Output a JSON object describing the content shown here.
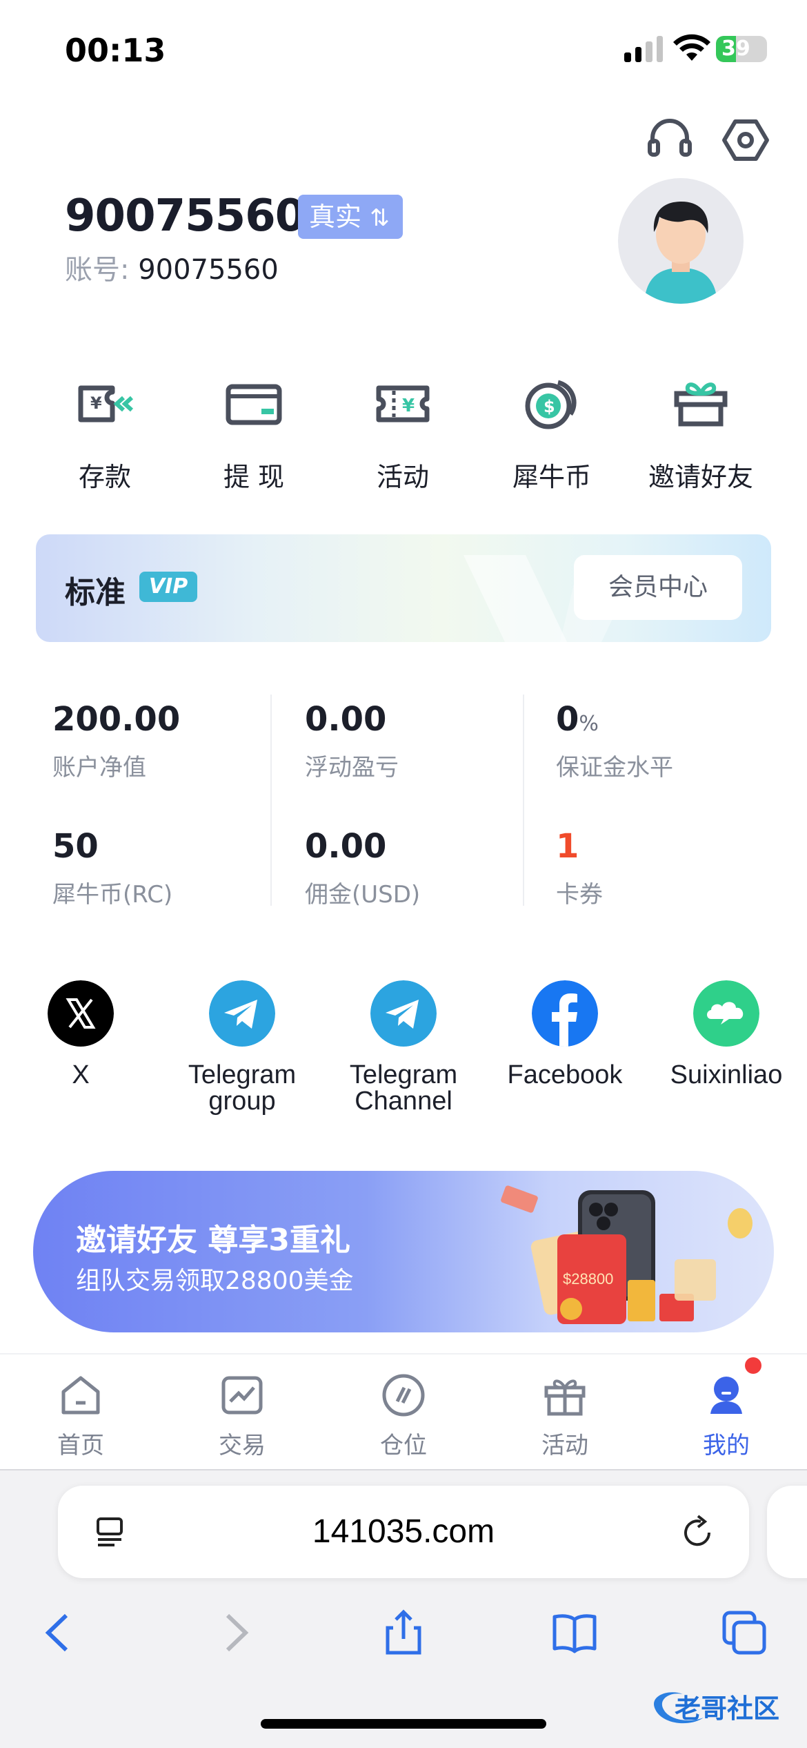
{
  "status_bar": {
    "time": "00:13",
    "battery": "39",
    "battery_level": 0.39
  },
  "profile": {
    "name": "90075560",
    "badge": "真实",
    "account_label": "账号:",
    "account_number": "90075560"
  },
  "quick_actions": [
    {
      "label": "存款",
      "icon": "deposit-icon"
    },
    {
      "label": "提 现",
      "icon": "withdraw-card-icon"
    },
    {
      "label": "活动",
      "icon": "ticket-icon"
    },
    {
      "label": "犀牛币",
      "icon": "coin-icon"
    },
    {
      "label": "邀请好友",
      "icon": "gift-box-icon"
    }
  ],
  "vip": {
    "level": "标准",
    "badge": "VIP",
    "center_button": "会员中心"
  },
  "stats": [
    {
      "value": "200.00",
      "label": "账户净值"
    },
    {
      "value": "0.00",
      "label": "浮动盈亏"
    },
    {
      "value": "0",
      "unit": "%",
      "label": "保证金水平"
    },
    {
      "value": "50",
      "label": "犀牛币(RC)"
    },
    {
      "value": "0.00",
      "label": "佣金(USD)"
    },
    {
      "value": "1",
      "label": "卡券"
    }
  ],
  "social": [
    {
      "label": "X",
      "icon": "x-logo-icon",
      "color": "#000000"
    },
    {
      "label": "Telegram group",
      "icon": "telegram-icon",
      "color": "#2ca4e0"
    },
    {
      "label": "Telegram Channel",
      "icon": "telegram-icon",
      "color": "#2ca4e0"
    },
    {
      "label": "Facebook",
      "icon": "facebook-icon",
      "color": "#1877f2"
    },
    {
      "label": "Suixinliao",
      "icon": "chat-cloud-icon",
      "color": "#2fd08a"
    }
  ],
  "banner": {
    "title": "邀请好友 尊享3重礼",
    "subtitle": "组队交易领取28800美金",
    "amount": "$28800"
  },
  "tabs": [
    {
      "label": "首页",
      "icon": "home-icon",
      "active": false
    },
    {
      "label": "交易",
      "icon": "chart-icon",
      "active": false
    },
    {
      "label": "仓位",
      "icon": "position-icon",
      "active": false
    },
    {
      "label": "活动",
      "icon": "gift-icon",
      "active": false
    },
    {
      "label": "我的",
      "icon": "user-icon",
      "active": true
    }
  ],
  "browser": {
    "url": "141035.com"
  },
  "watermark": {
    "text": "老哥社区"
  },
  "colors": {
    "accent": "#3b63e8",
    "badge": "#8ea8f5",
    "vip_badge": "#3fb8d6",
    "alert": "#f04b2b"
  }
}
